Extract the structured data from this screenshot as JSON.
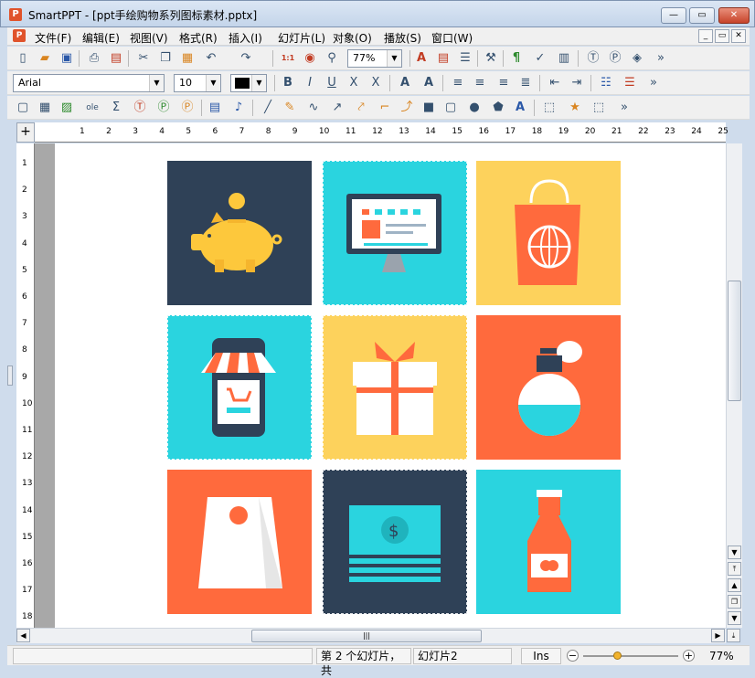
{
  "window": {
    "app_icon": "P",
    "title": "SmartPPT - [ppt手绘购物系列图标素材.pptx]",
    "minimize": "—",
    "maximize": "▭",
    "close": "✕"
  },
  "menu": {
    "doc_icon": "P",
    "items": [
      "文件(F)",
      "编辑(E)",
      "视图(V)",
      "格式(R)",
      "插入(I)",
      "幻灯片(L)",
      "对象(O)",
      "播放(S)",
      "窗口(W)"
    ],
    "mdi_min": "_",
    "mdi_restore": "▭",
    "mdi_close": "✕"
  },
  "toolbar1": {
    "zoom": "77%",
    "actual_size": "1:1",
    "more": "»"
  },
  "toolbar2": {
    "font": "Arial",
    "size": "10",
    "bold": "B",
    "italic": "I",
    "underline": "U",
    "strike": "X",
    "clear": "X",
    "grow": "A",
    "shrink": "A",
    "more": "»"
  },
  "toolbar3": {
    "more": "»"
  },
  "ruler": {
    "h_ticks": [
      "1",
      "2",
      "3",
      "4",
      "5",
      "6",
      "7",
      "8",
      "9",
      "10",
      "11",
      "12",
      "13",
      "14",
      "15",
      "16",
      "17",
      "18",
      "19",
      "20",
      "21",
      "22",
      "23",
      "24",
      "25"
    ],
    "v_ticks": [
      "1",
      "2",
      "3",
      "4",
      "5",
      "6",
      "7",
      "8",
      "9",
      "10",
      "11",
      "12",
      "13",
      "14",
      "15",
      "16",
      "17",
      "18"
    ]
  },
  "status": {
    "slide_info": "第 2 个幻灯片，共",
    "slide_name": "幻灯片2",
    "mode": "Ins",
    "zoom": "77%"
  },
  "colors": {
    "navy": "#2f4157",
    "cyan": "#2ad4df",
    "yellow": "#fdd25c",
    "orange": "#ff6a3d"
  },
  "scroll": {
    "grip": "|||"
  }
}
